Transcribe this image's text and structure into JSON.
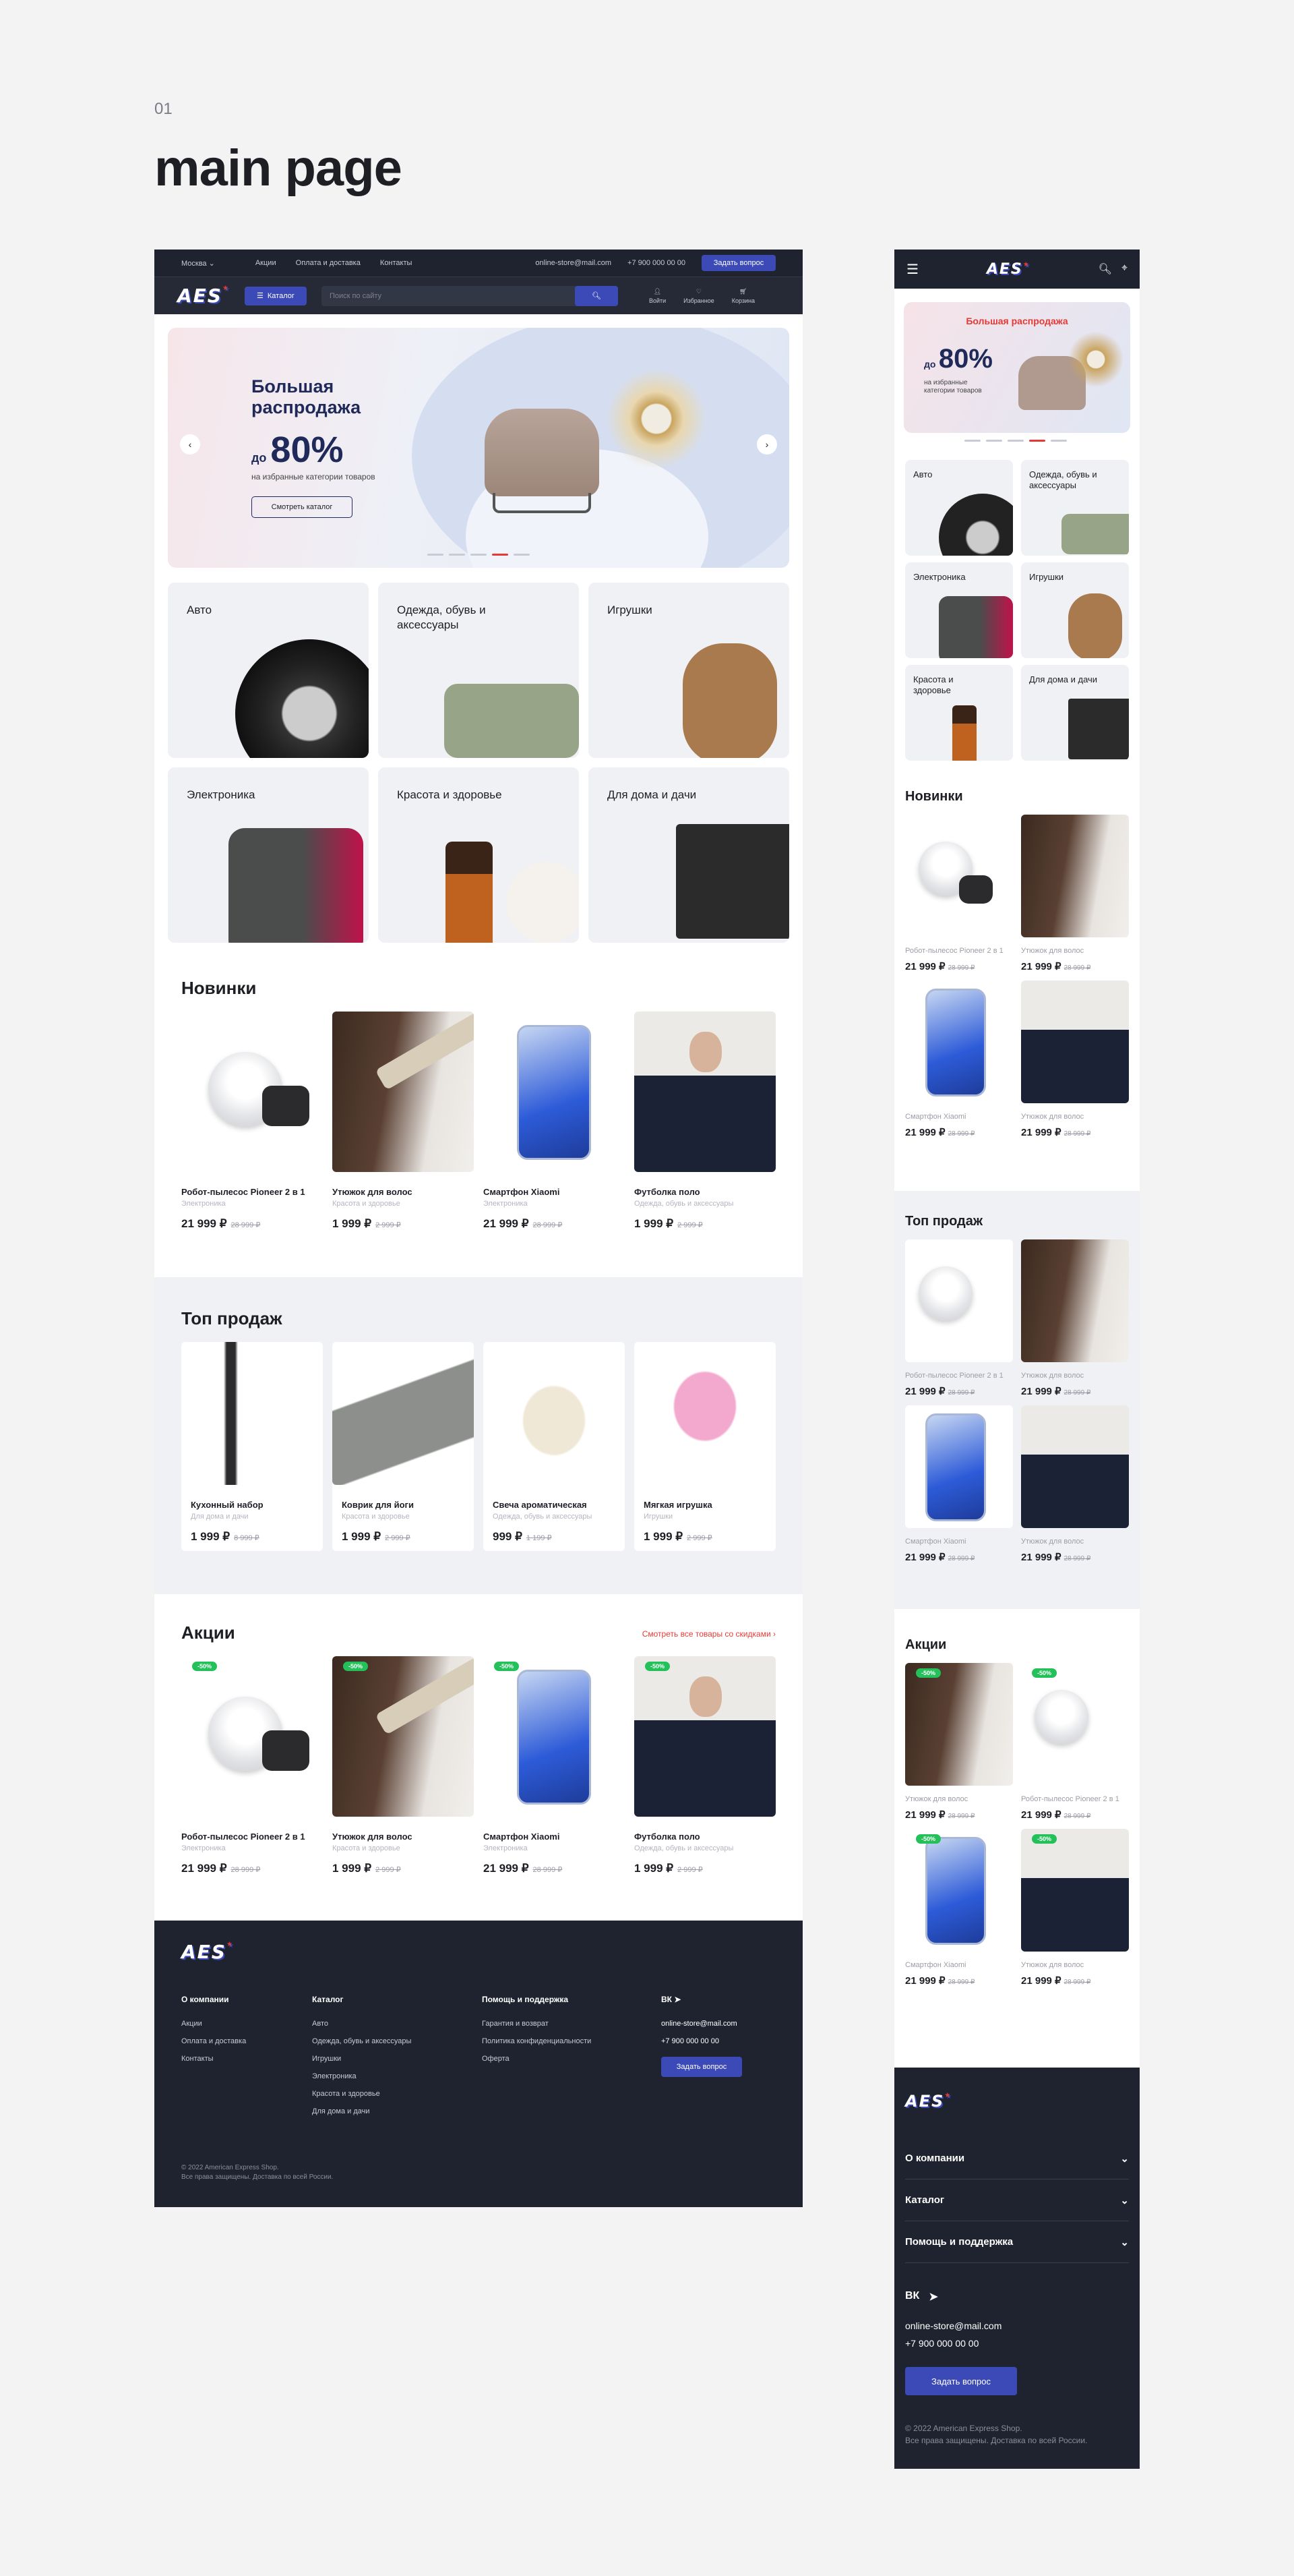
{
  "page": {
    "number": "01",
    "title": "main page"
  },
  "header": {
    "city": "Москва",
    "links": [
      "Акции",
      "Оплата и доставка",
      "Контакты"
    ],
    "email": "online-store@mail.com",
    "phone": "+7 900 000 00 00",
    "ask": "Задать вопрос",
    "logo": "AES",
    "catalog": "Каталог",
    "search_placeholder": "Поиск по сайту",
    "icons": [
      "Войти",
      "Избранное",
      "Корзина"
    ]
  },
  "hero": {
    "title": "Большая распродажа",
    "prefix": "до",
    "percent": "80%",
    "subtitle": "на избранные категории товаров",
    "button": "Смотреть каталог"
  },
  "categories": [
    "Авто",
    "Одежда, обувь и аксессуары",
    "Игрушки",
    "Электроника",
    "Красота и здоровье",
    "Для дома и дачи"
  ],
  "new": {
    "title": "Новинки",
    "items": [
      {
        "name": "Робот-пылесос Pioneer 2 в 1",
        "cat": "Электроника",
        "price": "21 999 ₽",
        "old": "28 999 ₽"
      },
      {
        "name": "Утюжок для волос",
        "cat": "Красота и здоровье",
        "price": "1 999 ₽",
        "old": "2 999 ₽"
      },
      {
        "name": "Смартфон Xiaomi",
        "cat": "Электроника",
        "price": "21 999 ₽",
        "old": "28 999 ₽"
      },
      {
        "name": "Футболка поло",
        "cat": "Одежда, обувь и аксессуары",
        "price": "1 999 ₽",
        "old": "2 999 ₽"
      }
    ]
  },
  "top": {
    "title": "Топ продаж",
    "items": [
      {
        "name": "Кухонный набор",
        "cat": "Для дома и дачи",
        "price": "1 999 ₽",
        "old": "8 999 ₽"
      },
      {
        "name": "Коврик для йоги",
        "cat": "Красота и здоровье",
        "price": "1 999 ₽",
        "old": "2 999 ₽"
      },
      {
        "name": "Свеча ароматическая",
        "cat": "Одежда, обувь и аксессуары",
        "price": "999 ₽",
        "old": "1 199 ₽"
      },
      {
        "name": "Мягкая игрушка",
        "cat": "Игрушки",
        "price": "1 999 ₽",
        "old": "2 999 ₽"
      }
    ]
  },
  "sale": {
    "title": "Акции",
    "link": "Смотреть все товары со скидками",
    "badge": "-50%",
    "items": [
      {
        "name": "Робот-пылесос Pioneer 2 в 1",
        "cat": "Электроника",
        "price": "21 999 ₽",
        "old": "28 999 ₽"
      },
      {
        "name": "Утюжок для волос",
        "cat": "Красота и здоровье",
        "price": "1 999 ₽",
        "old": "2 999 ₽"
      },
      {
        "name": "Смартфон Xiaomi",
        "cat": "Электроника",
        "price": "21 999 ₽",
        "old": "28 999 ₽"
      },
      {
        "name": "Футболка поло",
        "cat": "Одежда, обувь и аксессуары",
        "price": "1 999 ₽",
        "old": "2 999 ₽"
      }
    ]
  },
  "footer": {
    "about": {
      "title": "О компании",
      "items": [
        "Акции",
        "Оплата и доставка",
        "Контакты"
      ]
    },
    "catalog": {
      "title": "Каталог",
      "items": [
        "Авто",
        "Одежда, обувь и аксессуары",
        "Игрушки",
        "Электроника",
        "Красота и здоровье",
        "Для дома и дачи"
      ]
    },
    "help": {
      "title": "Помощь и поддержка",
      "items": [
        "Гарантия и возврат",
        "Политика конфиденциальности",
        "Оферта"
      ]
    },
    "copy1": "© 2022 American Express Shop.",
    "copy2": "Все права защищены. Доставка по всей России."
  },
  "mobile": {
    "hero_title": "Большая распродажа",
    "cats": [
      "Авто",
      "Одежда, обувь и аксессуары",
      "Электроника",
      "Игрушки",
      "Красота и здоровье",
      "Для дома и дачи"
    ],
    "new_items": [
      {
        "name": "Робот-пылесос Pioneer 2 в 1",
        "price": "21 999 ₽",
        "old": "28 999 ₽"
      },
      {
        "name": "Утюжок для волос",
        "price": "21 999 ₽",
        "old": "28 999 ₽"
      },
      {
        "name": "Смартфон Xiaomi",
        "price": "21 999 ₽",
        "old": "28 999 ₽"
      },
      {
        "name": "Утюжок для волос",
        "price": "21 999 ₽",
        "old": "28 999 ₽"
      }
    ],
    "sale_items": [
      {
        "name": "Утюжок для волос",
        "price": "21 999 ₽",
        "old": "28 999 ₽"
      },
      {
        "name": "Робот-пылесос Pioneer 2 в 1",
        "price": "21 999 ₽",
        "old": "28 999 ₽"
      },
      {
        "name": "Смартфон Xiaomi",
        "price": "21 999 ₽",
        "old": "28 999 ₽"
      },
      {
        "name": "Утюжок для волос",
        "price": "21 999 ₽",
        "old": "28 999 ₽"
      }
    ]
  },
  "colors": {
    "dark": "#1f2330",
    "accent": "#3c4ab7",
    "red": "#e53935",
    "green": "#24c05a"
  }
}
